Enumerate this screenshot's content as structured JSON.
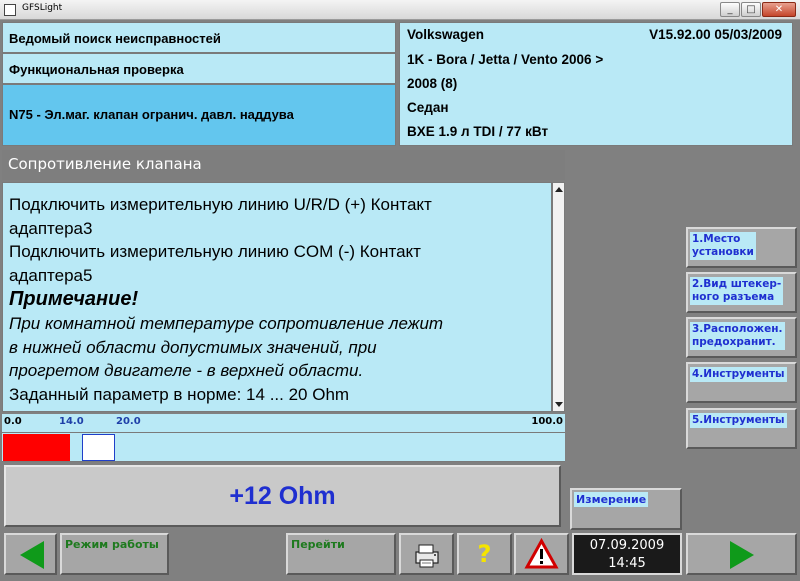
{
  "window": {
    "title": "GFSLight",
    "controls": [
      "_",
      "□",
      "✕"
    ]
  },
  "header": {
    "line1": "Ведомый поиск неисправностей",
    "line2": "Функциональная проверка",
    "line3": "N75 - Эл.маг. клапан огранич. давл. наддува"
  },
  "vehicle": {
    "make": "Volkswagen",
    "version": "V15.92.00 05/03/2009",
    "model_line1": "1K - Bora / Jetta / Vento 2006 >",
    "model_line2": "2008 (8)",
    "body": "Седан",
    "engine": "BXE 1.9 л TDI / 77 кВт"
  },
  "section": {
    "title": "Сопротивление клапана"
  },
  "instructions": {
    "line1": "Подключить измерительную линию U/R/D (+) Контакт",
    "line2": "адаптера3",
    "line3": "Подключить измерительную линию COM (-) Контакт",
    "line4": "адаптера5",
    "note_title": "Примечание!",
    "note_line1": " При комнатной температуре сопротивление лежит",
    "note_line2": "в нижней области допустимых значений, при",
    "note_line3": "прогретом двигателе - в верхней области.",
    "spec": "Заданный параметр в норме:   14 ... 20 Ohm"
  },
  "scale": {
    "min_label": "0.0",
    "lower_label": "14.0",
    "upper_label": "20.0",
    "max_label": "100.0",
    "min": 0,
    "max": 100,
    "lower": 14,
    "upper": 20,
    "current": 12,
    "fill_color": "#ff0000",
    "marker_color": "#1f3fc9"
  },
  "measurement": {
    "value": "+12  Ohm",
    "button_label": "Измерение"
  },
  "side_buttons": {
    "b1": [
      "1.Место",
      "установки"
    ],
    "b2": [
      "2.Вид штекер-",
      "ного разъема"
    ],
    "b3": [
      "3.Расположен.",
      "предохранит."
    ],
    "b4": [
      "4.Инструменты"
    ],
    "b5": [
      "5.Инструменты"
    ]
  },
  "toolbar": {
    "mode_label": "Режим работы",
    "goto_label": "Перейти",
    "help_symbol": "?",
    "back_icon": "arrow-left-icon",
    "forward_icon": "arrow-right-icon",
    "print_icon": "printer-icon",
    "warning_icon": "warning-icon",
    "date": "07.09.2009",
    "time": "14:45"
  },
  "colors": {
    "panel_light_blue": "#b9e9f6",
    "panel_medium_blue": "#63c6ee",
    "button_text_blue": "#1f2fd0",
    "button_text_green": "#1e7a1e",
    "arrow_green": "#0f9a1a"
  }
}
